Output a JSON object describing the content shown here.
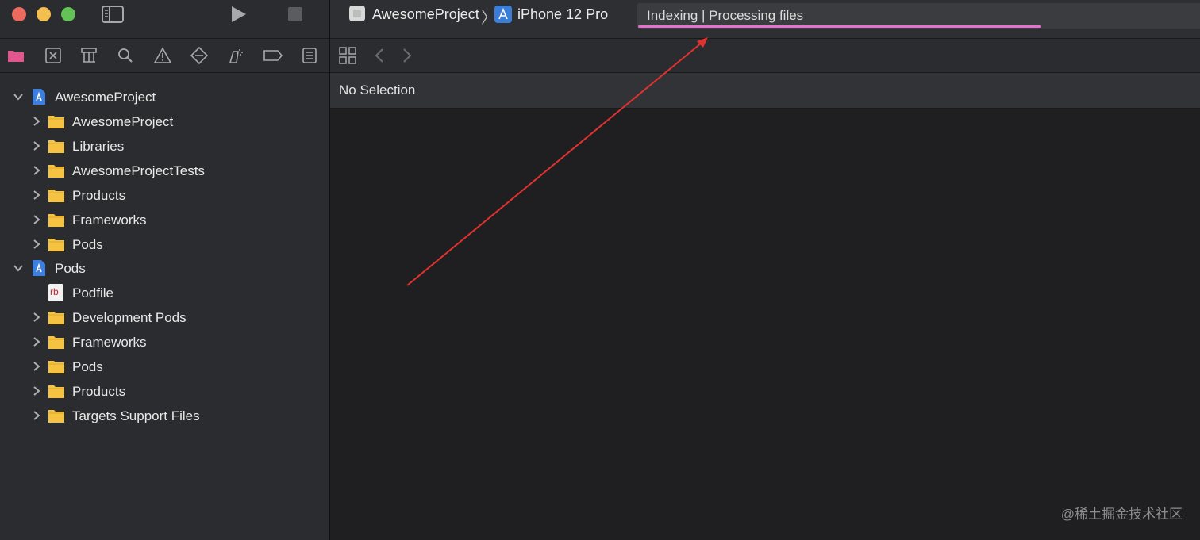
{
  "toolbar": {
    "scheme": "AwesomeProject",
    "device": "iPhone 12 Pro",
    "activity_status": "Indexing | Processing files",
    "progress": 0.72
  },
  "navigator_icons": [
    "folder-icon",
    "source-control-icon",
    "symbol-icon",
    "find-icon",
    "issue-icon",
    "test-icon",
    "debug-icon",
    "breakpoint-icon",
    "report-icon"
  ],
  "tree": [
    {
      "label": "AwesomeProject",
      "type": "project",
      "expanded": true
    },
    {
      "label": "AwesomeProject",
      "type": "folder"
    },
    {
      "label": "Libraries",
      "type": "folder"
    },
    {
      "label": "AwesomeProjectTests",
      "type": "folder"
    },
    {
      "label": "Products",
      "type": "folder"
    },
    {
      "label": "Frameworks",
      "type": "folder"
    },
    {
      "label": "Pods",
      "type": "folder"
    },
    {
      "label": "Pods",
      "type": "project",
      "expanded": true
    },
    {
      "label": "Podfile",
      "type": "ruby-file",
      "icon_text": "rb"
    },
    {
      "label": "Development Pods",
      "type": "folder"
    },
    {
      "label": "Frameworks",
      "type": "folder"
    },
    {
      "label": "Pods",
      "type": "folder"
    },
    {
      "label": "Products",
      "type": "folder"
    },
    {
      "label": "Targets Support Files",
      "type": "folder"
    }
  ],
  "editor": {
    "header": "No Selection"
  },
  "watermark": "@稀土掘金技术社区",
  "colors": {
    "accent": "#e76fcf",
    "folder": "#f5c242",
    "arrow": "#e0322f"
  }
}
